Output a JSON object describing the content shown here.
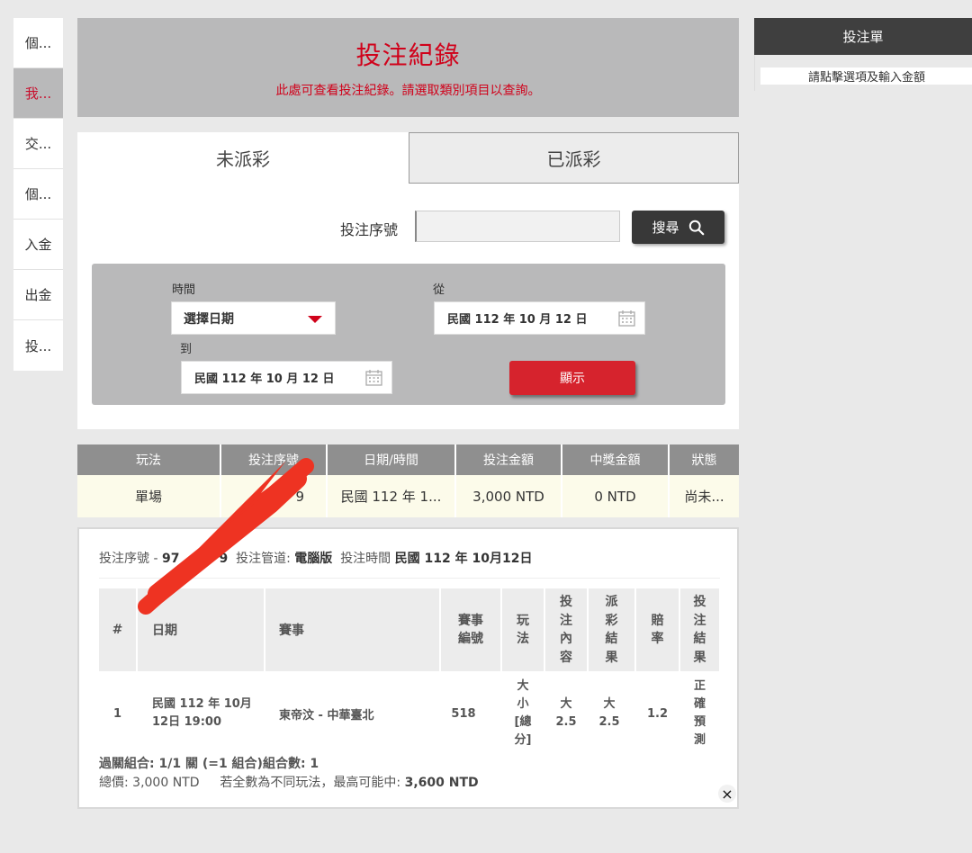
{
  "left_nav": [
    {
      "label": "個..."
    },
    {
      "label": "我...",
      "active": true
    },
    {
      "label": "交..."
    },
    {
      "label": "個..."
    },
    {
      "label": "入金"
    },
    {
      "label": "出金"
    },
    {
      "label": "投..."
    }
  ],
  "header": {
    "title": "投注紀錄",
    "subtitle": "此處可查看投注紀錄。請選取類別項目以查詢。"
  },
  "tabs": [
    {
      "label": "未派彩",
      "active": true
    },
    {
      "label": "已派彩"
    }
  ],
  "search": {
    "label": "投注序號",
    "value": "",
    "button_label": "搜尋"
  },
  "filter": {
    "time_label": "時間",
    "time_value": "選擇日期",
    "from_label": "從",
    "from_value": "民國 112 年 10 月 12 日",
    "to_label": "到",
    "to_value": "民國 112 年 10 月 12 日",
    "show_button": "顯示"
  },
  "results": {
    "headers": [
      "玩法",
      "投注序號",
      "日期/時間",
      "投注金額",
      "中獎金額",
      "狀態"
    ],
    "row": [
      "單場",
      "9",
      "民國 112 年 1...",
      "3,000 NTD",
      "0 NTD",
      "尚未..."
    ]
  },
  "detail": {
    "serial_label": "投注序號",
    "serial_sep": "-",
    "serial_value": "97",
    "serial_tail": "9",
    "channel_label": "投注管道:",
    "channel_value": "電腦版",
    "time_label": "投注時間",
    "time_value": "民國 112 年 10月12日",
    "headers": {
      "no": "#",
      "date": "日期",
      "match": "賽事",
      "match_no": [
        "賽事",
        "編號"
      ],
      "play": [
        "玩",
        "法"
      ],
      "content": [
        "投",
        "注",
        "內",
        "容"
      ],
      "payout": [
        "派",
        "彩",
        "結",
        "果"
      ],
      "odds": [
        "賠",
        "率"
      ],
      "result": [
        "投",
        "注",
        "結",
        "果"
      ]
    },
    "row": {
      "no": "1",
      "date": [
        "民國 112 年 10月",
        "12日 19:00"
      ],
      "match": "東帝汶 - 中華臺北",
      "match_no": "518",
      "play": [
        "大",
        "小",
        "[總",
        "分]"
      ],
      "content": [
        "大",
        "2.5"
      ],
      "payout": [
        "大",
        "2.5"
      ],
      "odds": "1.2",
      "result": [
        "正",
        "確",
        "預",
        "測"
      ]
    },
    "combo": "過關組合: 1/1 關 (=1 組合)組合數: 1",
    "total_label": "總價:",
    "total_value": "3,000 NTD",
    "max_label": "若全數為不同玩法，最高可能中:",
    "max_value": "3,600 NTD",
    "close": "×"
  },
  "betslip": {
    "title": "投注單",
    "hint": "請點擊選項及輸入金額"
  },
  "colors": {
    "accent_red": "#d0021b",
    "button_red": "#d6232d",
    "header_gray": "#b9b9ba",
    "dark": "#3f3f3f"
  }
}
